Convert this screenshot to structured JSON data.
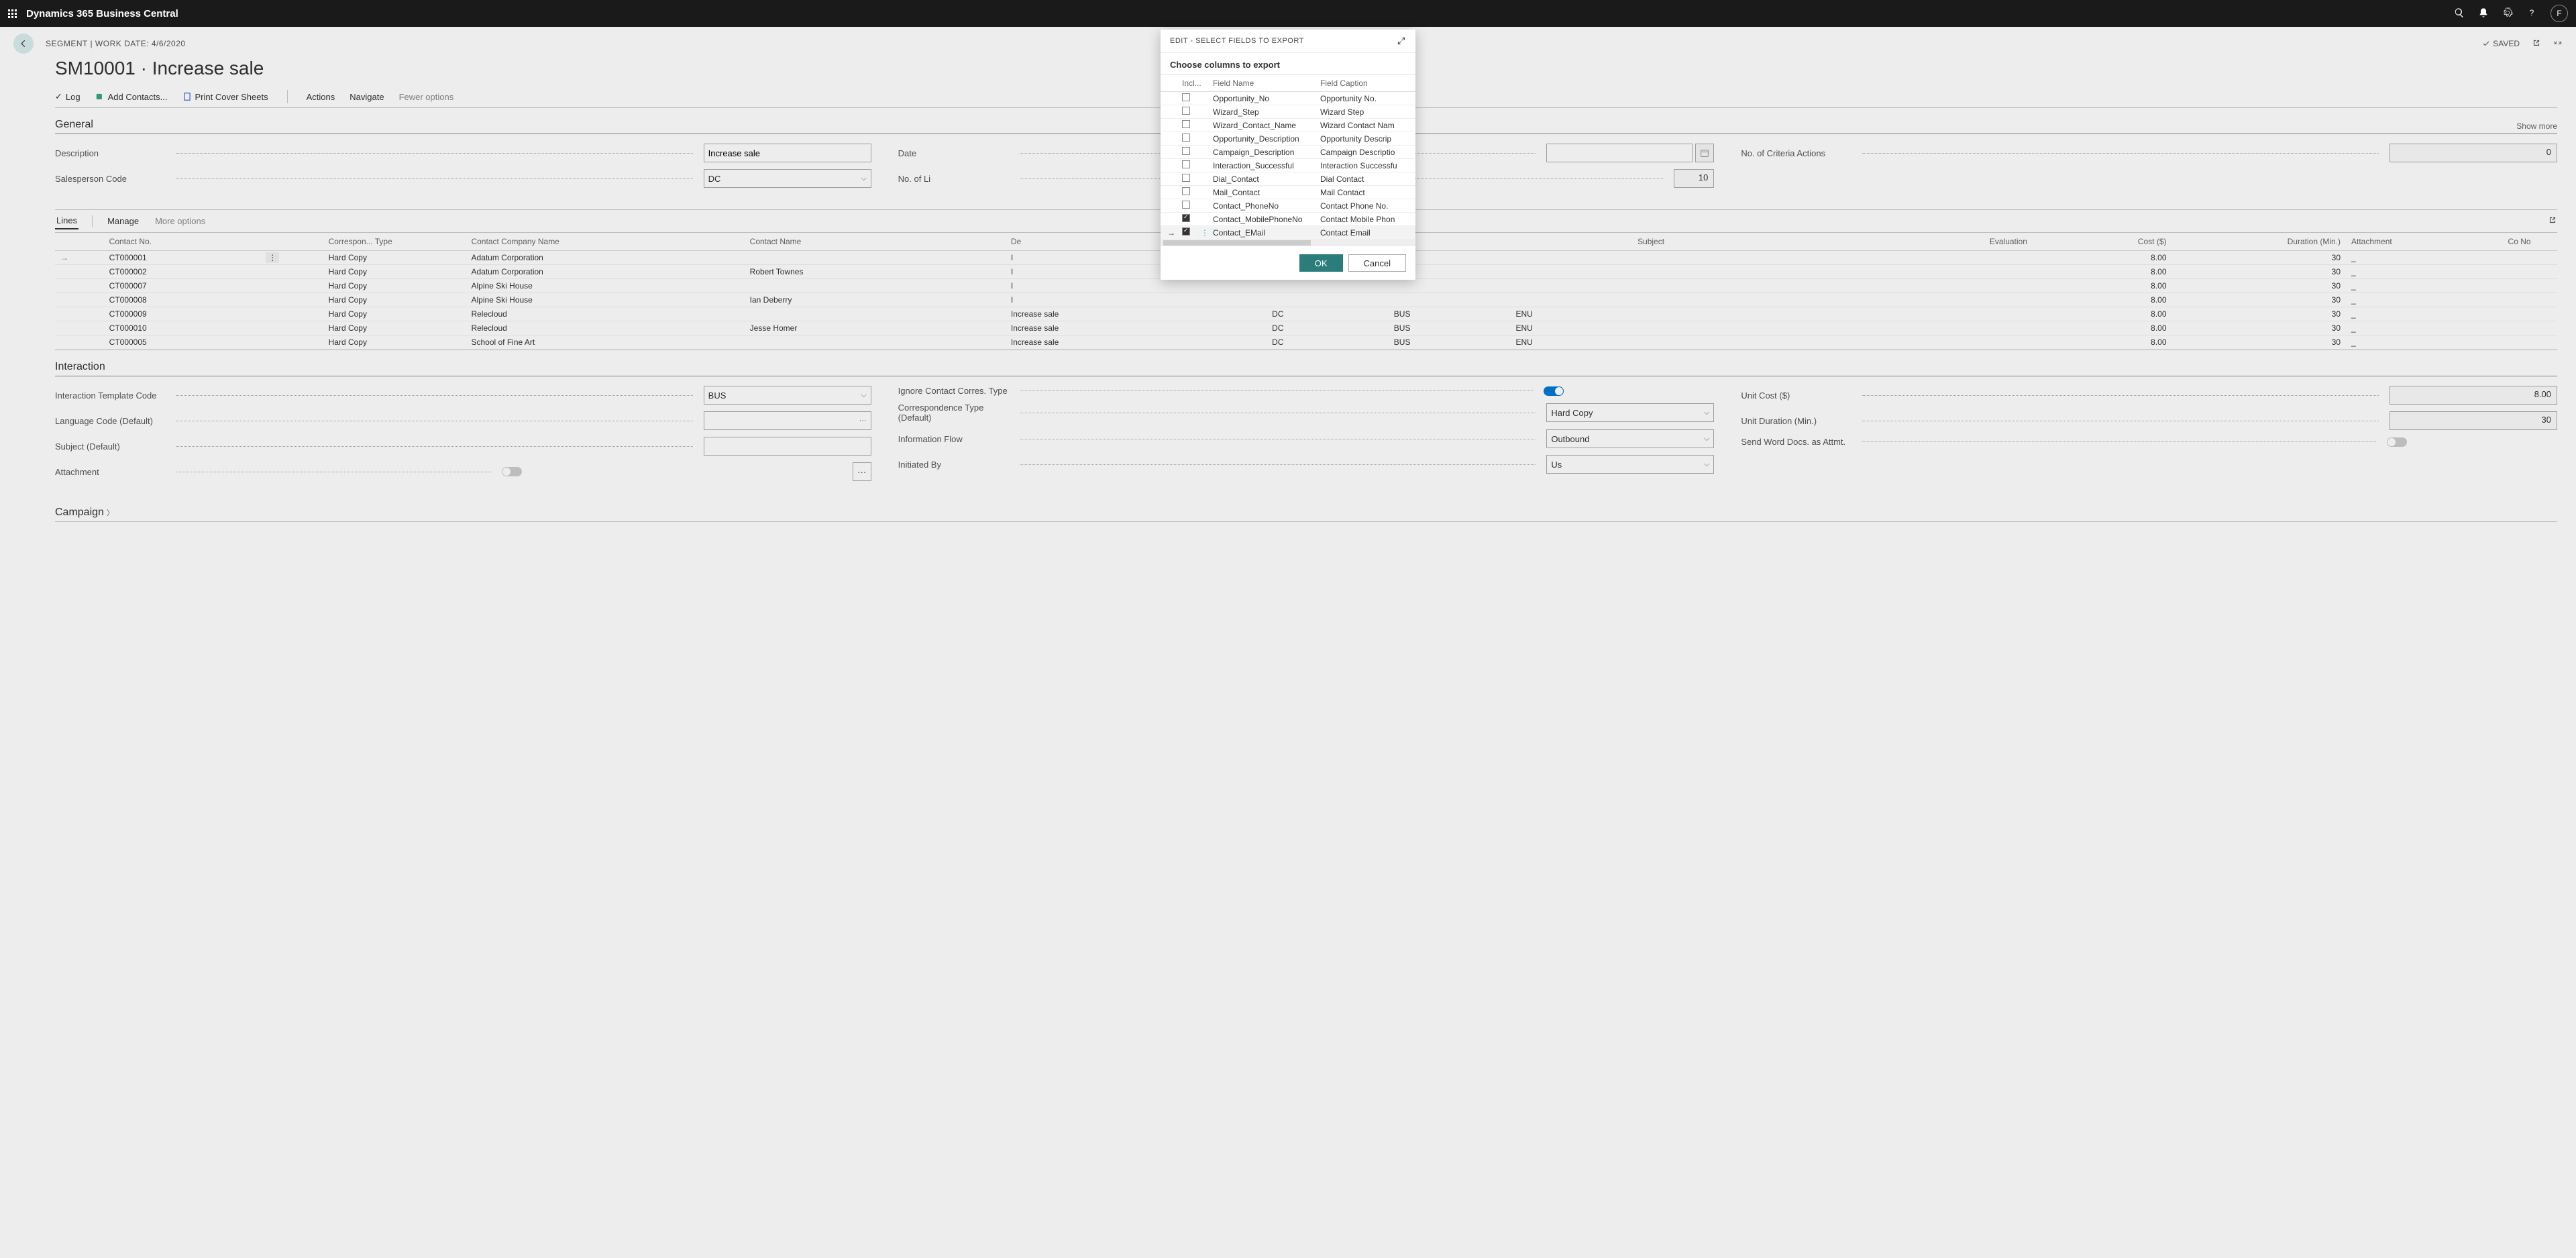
{
  "topbar": {
    "app_title": "Dynamics 365 Business Central",
    "avatar_initial": "F"
  },
  "page": {
    "crumb": "SEGMENT | WORK DATE: 4/6/2020",
    "title": "SM10001 · Increase sale",
    "saved_label": "SAVED"
  },
  "actions": {
    "log": "Log",
    "add_contacts": "Add Contacts...",
    "print_cover": "Print Cover Sheets",
    "actions": "Actions",
    "navigate": "Navigate",
    "fewer": "Fewer options"
  },
  "sections": {
    "general": "General",
    "show_more": "Show more",
    "lines": "Lines",
    "manage": "Manage",
    "more_options": "More options",
    "interaction": "Interaction",
    "campaign": "Campaign"
  },
  "general_fields": {
    "description_label": "Description",
    "description_value": "Increase sale",
    "salesperson_label": "Salesperson Code",
    "salesperson_value": "DC",
    "date_label": "Date",
    "no_lines_label": "No. of Li",
    "no_lines_value": "10",
    "criteria_label": "No. of Criteria Actions",
    "criteria_value": "0"
  },
  "lines_columns": {
    "contact_no": "Contact No.",
    "correspon": "Correspon... Type",
    "company": "Contact Company Name",
    "contact_name": "Contact Name",
    "desc": "De",
    "subject": "Subject",
    "evaluation": "Evaluation",
    "cost": "Cost ($)",
    "duration": "Duration (Min.)",
    "attachment": "Attachment",
    "cno": "Co No"
  },
  "lines_rows": [
    {
      "contact": "CT000001",
      "corr": "Hard Copy",
      "company": "Adatum Corporation",
      "name": "",
      "desc": "I",
      "sp": "",
      "camp": "",
      "lang": "",
      "cost": "8.00",
      "dur": "30",
      "att": "_"
    },
    {
      "contact": "CT000002",
      "corr": "Hard Copy",
      "company": "Adatum Corporation",
      "name": "Robert Townes",
      "desc": "I",
      "sp": "",
      "camp": "",
      "lang": "",
      "cost": "8.00",
      "dur": "30",
      "att": "_"
    },
    {
      "contact": "CT000007",
      "corr": "Hard Copy",
      "company": "Alpine Ski House",
      "name": "",
      "desc": "I",
      "sp": "",
      "camp": "",
      "lang": "",
      "cost": "8.00",
      "dur": "30",
      "att": "_"
    },
    {
      "contact": "CT000008",
      "corr": "Hard Copy",
      "company": "Alpine Ski House",
      "name": "Ian Deberry",
      "desc": "I",
      "sp": "",
      "camp": "",
      "lang": "",
      "cost": "8.00",
      "dur": "30",
      "att": "_"
    },
    {
      "contact": "CT000009",
      "corr": "Hard Copy",
      "company": "Relecloud",
      "name": "",
      "desc": "Increase sale",
      "sp": "DC",
      "camp": "BUS",
      "lang": "ENU",
      "cost": "8.00",
      "dur": "30",
      "att": "_"
    },
    {
      "contact": "CT000010",
      "corr": "Hard Copy",
      "company": "Relecloud",
      "name": "Jesse Homer",
      "desc": "Increase sale",
      "sp": "DC",
      "camp": "BUS",
      "lang": "ENU",
      "cost": "8.00",
      "dur": "30",
      "att": "_"
    },
    {
      "contact": "CT000005",
      "corr": "Hard Copy",
      "company": "School of Fine Art",
      "name": "",
      "desc": "Increase sale",
      "sp": "DC",
      "camp": "BUS",
      "lang": "ENU",
      "cost": "8.00",
      "dur": "30",
      "att": "_"
    }
  ],
  "interaction_fields": {
    "template_label": "Interaction Template Code",
    "template_value": "BUS",
    "lang_label": "Language Code (Default)",
    "subject_label": "Subject (Default)",
    "attachment_label": "Attachment",
    "ignore_label": "Ignore Contact Corres. Type",
    "corr_type_label": "Correspondence Type (Default)",
    "corr_type_value": "Hard Copy",
    "info_flow_label": "Information Flow",
    "info_flow_value": "Outbound",
    "initiated_label": "Initiated By",
    "initiated_value": "Us",
    "unit_cost_label": "Unit Cost ($)",
    "unit_cost_value": "8.00",
    "unit_dur_label": "Unit Duration (Min.)",
    "unit_dur_value": "30",
    "send_word_label": "Send Word Docs. as Attmt."
  },
  "modal": {
    "title": "EDIT - SELECT FIELDS TO EXPORT",
    "subtitle": "Choose columns to export",
    "col_incl": "Incl...",
    "col_field": "Field Name",
    "col_caption": "Field Caption",
    "rows": [
      {
        "checked": false,
        "field": "Opportunity_No",
        "caption": "Opportunity No."
      },
      {
        "checked": false,
        "field": "Wizard_Step",
        "caption": "Wizard Step"
      },
      {
        "checked": false,
        "field": "Wizard_Contact_Name",
        "caption": "Wizard Contact Nam"
      },
      {
        "checked": false,
        "field": "Opportunity_Description",
        "caption": "Opportunity Descrip"
      },
      {
        "checked": false,
        "field": "Campaign_Description",
        "caption": "Campaign Descriptio"
      },
      {
        "checked": false,
        "field": "Interaction_Successful",
        "caption": "Interaction Successfu"
      },
      {
        "checked": false,
        "field": "Dial_Contact",
        "caption": "Dial Contact"
      },
      {
        "checked": false,
        "field": "Mail_Contact",
        "caption": "Mail Contact"
      },
      {
        "checked": false,
        "field": "Contact_PhoneNo",
        "caption": "Contact Phone No."
      },
      {
        "checked": true,
        "field": "Contact_MobilePhoneNo",
        "caption": "Contact Mobile Phon"
      },
      {
        "checked": true,
        "field": "Contact_EMail",
        "caption": "Contact Email",
        "active": true
      }
    ],
    "ok": "OK",
    "cancel": "Cancel"
  }
}
